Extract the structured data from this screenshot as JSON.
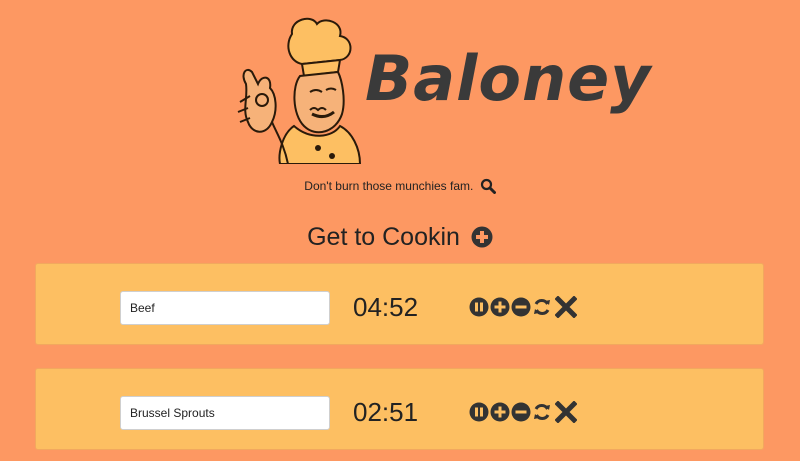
{
  "header": {
    "brand": "Baloney",
    "tagline": "Don't burn those munchies fam.",
    "tagline_icon": "search-icon",
    "logo_icon": "chef-icon"
  },
  "add_timer": {
    "label": "Get to Cookin",
    "icon": "plus-circle-icon"
  },
  "timers": [
    {
      "name": "Beef",
      "time": "04:52"
    },
    {
      "name": "Brussel Sprouts",
      "time": "02:51"
    }
  ],
  "control_icons": [
    "pause-icon",
    "plus-icon",
    "minus-icon",
    "reset-icon",
    "close-icon"
  ],
  "colors": {
    "background": "#fd9862",
    "card": "#fdbf62",
    "text": "#222222",
    "icon": "#333333"
  }
}
